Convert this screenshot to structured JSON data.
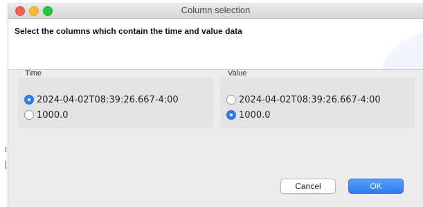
{
  "window": {
    "title": "Column selection"
  },
  "header": {
    "text": "Select the columns which contain the time and value data"
  },
  "groups": {
    "time": {
      "label": "Time",
      "options": [
        "2024-04-02T08:39:26.667-4:00",
        "1000.0"
      ],
      "selected_index": 0
    },
    "value": {
      "label": "Value",
      "options": [
        "2024-04-02T08:39:26.667-4:00",
        "1000.0"
      ],
      "selected_index": 1
    }
  },
  "buttons": {
    "cancel_label": "Cancel",
    "ok_label": "OK"
  },
  "colors": {
    "accent": "#2f7df6",
    "close": "#fd5f57",
    "minimize": "#fdbc2e",
    "maximize": "#27c840"
  }
}
